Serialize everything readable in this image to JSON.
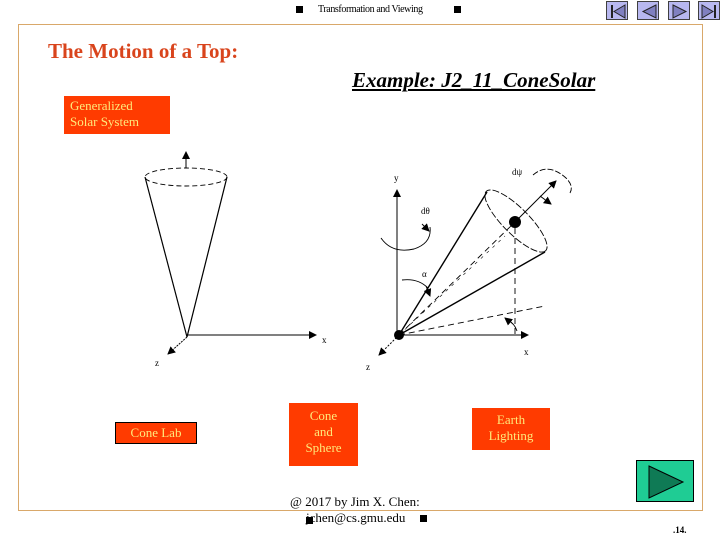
{
  "header": {
    "title": "Transformation and Viewing",
    "nav_buttons": [
      {
        "name": "first-slide",
        "icon": "first-icon"
      },
      {
        "name": "previous-slide",
        "icon": "previous-icon"
      },
      {
        "name": "next-slide",
        "icon": "next-icon"
      },
      {
        "name": "last-slide",
        "icon": "last-icon"
      }
    ]
  },
  "slide": {
    "title": "The Motion of a Top:",
    "example_link": "Example: J2_11_ConeSolar",
    "buttons": {
      "generalized": "Generalized Solar System",
      "generalized_line1": "Generalized",
      "generalized_line2": "Solar System",
      "cone_lab": "Cone Lab",
      "cone_sphere_line1": "Cone",
      "cone_sphere_line2": "and",
      "cone_sphere_line3": "Sphere",
      "earth_line1": "Earth",
      "earth_line2": "Lighting"
    },
    "left_diagram": {
      "axis_x": "x",
      "axis_z": "z"
    },
    "right_diagram": {
      "axis_y": "y",
      "axis_x": "x",
      "axis_z": "z",
      "label_dpsi": "dψ",
      "label_dtheta": "dθ",
      "label_alpha": "α"
    },
    "next_button_icon": "play-next-icon"
  },
  "footer": {
    "copyright": "@ 2017 by Jim X. Chen:",
    "email": "jchen@cs.gmu.edu",
    "page_number": ".14."
  },
  "colors": {
    "title": "#d9441c",
    "button_bg": "#ff3b00",
    "button_text": "#ffe97a",
    "frame": "#d9a86a",
    "next_button": "#1fcc94",
    "nav_button": "#b8b8f0"
  }
}
